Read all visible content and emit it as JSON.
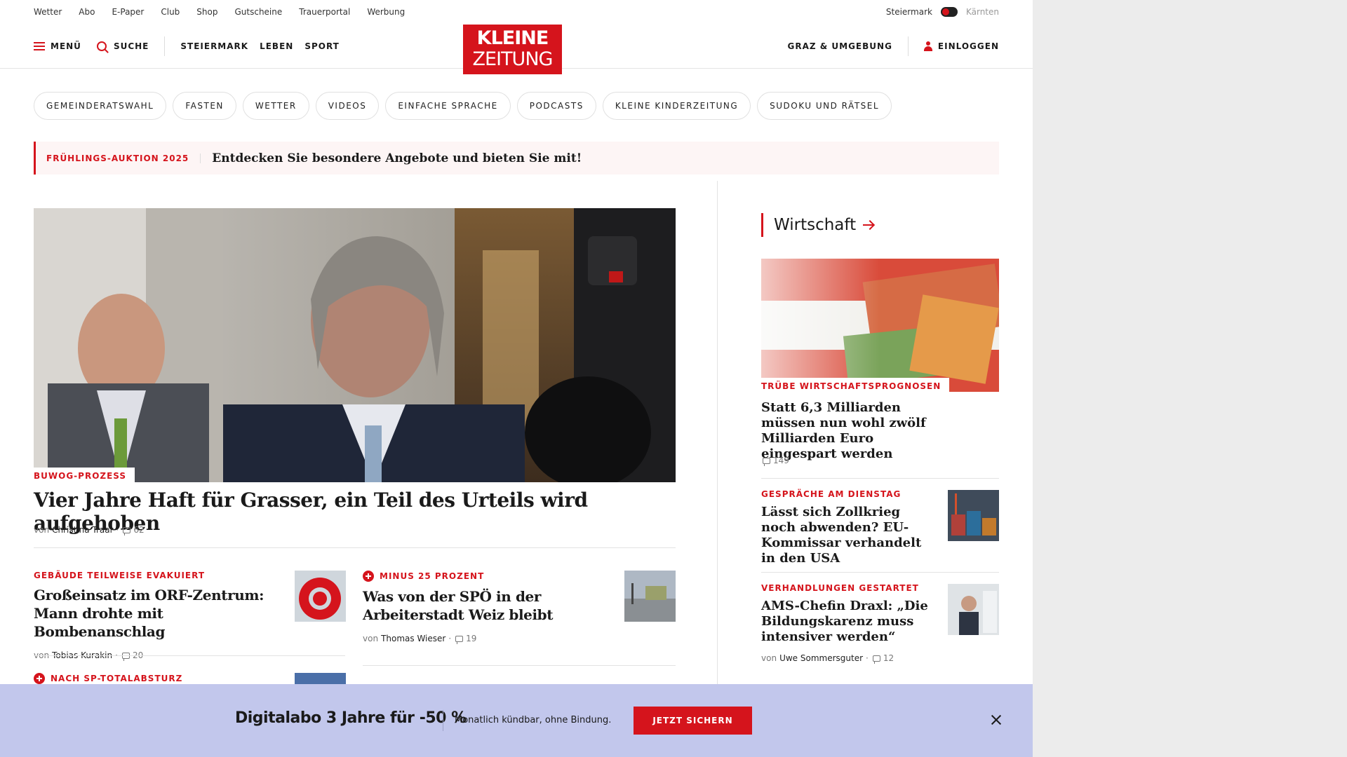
{
  "utility": {
    "links": [
      "Wetter",
      "Abo",
      "E-Paper",
      "Club",
      "Shop",
      "Gutscheine",
      "Trauerportal",
      "Werbung"
    ],
    "region_left": "Steiermark",
    "region_right": "Kärnten"
  },
  "nav": {
    "menu": "MENÜ",
    "search": "SUCHE",
    "sections": [
      "STEIERMARK",
      "LEBEN",
      "SPORT"
    ],
    "logo_line1": "KLEINE",
    "logo_line2": "ZEITUNG",
    "region": "GRAZ & UMGEBUNG",
    "login": "EINLOGGEN"
  },
  "pills": [
    "GEMEINDERATSWAHL",
    "FASTEN",
    "WETTER",
    "VIDEOS",
    "EINFACHE SPRACHE",
    "PODCASTS",
    "KLEINE KINDERZEITUNG",
    "SUDOKU UND RÄTSEL"
  ],
  "promo": {
    "kicker": "FRÜHLINGS-AUKTION 2025",
    "text": "Entdecken Sie besondere Angebote und bieten Sie mit!"
  },
  "hero": {
    "kicker": "BUWOG-PROZESS",
    "title": "Vier Jahre Haft für Grasser, ein Teil des Urteils wird aufgehoben",
    "by": "von",
    "author": "Christina Traar",
    "comments": "62"
  },
  "articles": [
    {
      "kicker": "GEBÄUDE TEILWEISE EVAKUIERT",
      "title": "Großeinsatz im ORF-Zentrum: Mann drohte mit Bombenanschlag",
      "by": "von",
      "author": "Tobias Kurakin",
      "comments": "20"
    },
    {
      "kicker": "MINUS 25 PROZENT",
      "title": "Was von der SPÖ in der Arbeiterstadt Weiz bleibt",
      "by": "von",
      "author": "Thomas Wieser",
      "comments": "19"
    },
    {
      "kicker": "NACH SP-TOTALABSTURZ"
    }
  ],
  "sidebar": {
    "section": "Wirtschaft",
    "items": [
      {
        "kicker": "TRÜBE WIRTSCHAFTSPROGNOSEN",
        "title": "Statt 6,3 Milliarden müssen nun wohl zwölf Milliarden Euro eingespart werden",
        "comments": "149"
      },
      {
        "kicker": "GESPRÄCHE AM DIENSTAG",
        "title": "Lässt sich Zollkrieg noch abwenden? EU-Kommissar verhandelt in den USA"
      },
      {
        "kicker": "VERHANDLUNGEN GESTARTET",
        "title": "AMS-Chefin Draxl: „Die Bildungskarenz muss intensiver werden“",
        "by": "von",
        "author": "Uwe Sommersguter",
        "comments": "12"
      }
    ]
  },
  "banner": {
    "title": "Digitalabo 3 Jahre für -50 %",
    "subtitle": "Monatlich kündbar, ohne Bindung.",
    "button": "JETZT SICHERN"
  },
  "colors": {
    "accent": "#d5141c",
    "banner": "#c2c7ec"
  }
}
